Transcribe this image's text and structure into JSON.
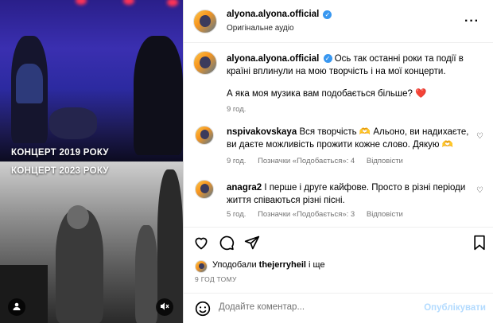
{
  "media": {
    "caption_top": "КОНЦЕРТ 2019 РОКУ",
    "caption_bottom": "КОНЦЕРТ 2023 РОКУ",
    "user_tag_icon": "person-icon",
    "sound_icon": "muted-speaker-icon"
  },
  "header": {
    "username": "alyona.alyona.official",
    "subtitle": "Оригінальне аудіо",
    "more_icon": "more-horizontal-icon"
  },
  "post": {
    "username": "alyona.alyona.official",
    "text": "Ось так останні роки та події в країні вплинули на мою творчість і на мої концерти.",
    "question": "А яка моя музика вам подобається більше?",
    "emoji": "❤️",
    "time": "9 год."
  },
  "comments": [
    {
      "username": "nspivakovskaya",
      "text": "Вся творчість 🫶 Альоно, ви надихаєте, ви даєте можливість прожити кожне слово. Дякую 🫶",
      "time": "9 год.",
      "likes": "Позначки «Подобається»: 4",
      "reply": "Відповісти"
    },
    {
      "username": "anagra2",
      "text": "І перше і друге кайфове. Просто в різні періоди життя співаються різні пісні.",
      "time": "5 год.",
      "likes": "Позначки «Подобається»: 3",
      "reply": "Відповісти"
    }
  ],
  "actions": {
    "like_icon": "heart-icon",
    "comment_icon": "comment-icon",
    "share_icon": "share-icon",
    "save_icon": "bookmark-icon"
  },
  "likes": {
    "prefix": "Уподобали",
    "user": "thejerryheil",
    "suffix": "і ще"
  },
  "timestamp": "9 ГОД ТОМУ",
  "comment_box": {
    "placeholder": "Додайте коментар...",
    "publish": "Опублікувати",
    "emoji_icon": "smiley-icon"
  },
  "colors": {
    "accent": "#0095f6",
    "publish_disabled": "#b3dbff",
    "verified": "#3897f0",
    "heart_red": "#e0245e"
  }
}
